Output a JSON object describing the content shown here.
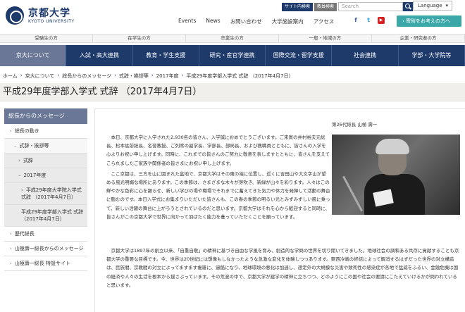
{
  "header": {
    "logo_jp": "京都大学",
    "logo_en": "KYOTO UNIVERSITY",
    "sitemap_btn": "サイト内検索",
    "staff_btn": "教員検索",
    "search_placeholder": "Search",
    "language": "Language",
    "nav": [
      "Events",
      "News",
      "お問い合わせ",
      "大学施設案内",
      "アクセス"
    ],
    "donate": "寄附をお考えの方へ"
  },
  "audience": [
    "受験生の方",
    "在学生の方",
    "卒業生の方",
    "一般・地域の方",
    "企業・研究者の方"
  ],
  "main_nav": [
    {
      "label": "京大について",
      "active": true
    },
    {
      "label": "入試・高大連携",
      "active": false
    },
    {
      "label": "教育・学生支援",
      "active": false
    },
    {
      "label": "研究・産官学連携",
      "active": false
    },
    {
      "label": "国際交流・留学支援",
      "active": false
    },
    {
      "label": "社会連携",
      "active": false
    },
    {
      "label": "学部・大学院等",
      "active": false
    }
  ],
  "breadcrumb": [
    "ホーム",
    "京大について",
    "総長からのメッセージ",
    "式辞・挨拶等",
    "2017年度",
    "平成29年度学部入学式 式辞 （2017年4月7日）"
  ],
  "page_title": "平成29年度学部入学式 式辞 （2017年4月7日）",
  "sidebar": {
    "heading": "総長からのメッセージ",
    "items": [
      {
        "label": "総長の動き",
        "level": 1
      },
      {
        "label": "式辞・挨拶等",
        "level": 2
      },
      {
        "label": "式辞",
        "level": 3
      },
      {
        "label": "2017年度",
        "level": 3
      },
      {
        "label": "平成29年度大学院入学式 式辞 （2017年4月7日）",
        "level": 4
      },
      {
        "label": "平成29年度学部入学式 式辞 （2017年4月7日）",
        "level": 4
      },
      {
        "label": "歴代総長",
        "level": 1
      },
      {
        "label": "山極壽一総長からのメッセージ",
        "level": 1
      },
      {
        "label": "山極壽一総長 特設サイト",
        "level": 1
      }
    ]
  },
  "content": {
    "president_label": "第26代総長 山極 壽一",
    "para1": "本日、京都大学に入学された2,930名の皆さん、入学誠におめでとうございます。ご来賓の井村裕夫元総長、松本紘前総長、名誉教授、ご列席の副学長、学部長、部局長、および教職員とともに、皆さんの入学を心よりお祝い申し上げます。同時に、これまでの皆さんのご努力に敬意を表しますとともに、皆さんを支えてこられましたご家族や関係者の皆さまにお祝い申し上げます。",
    "para2": "ここ京都は、三方を山に囲まれた盆地で、京都大学はその東の端に位置し、近くに吉田山や大文字山が望める風光明媚な場所にあります。この季節は、さまざまな木々が芽吹き、新緑が山々を彩ります。人々はこの鮮やかな色彩に心を躍らせ、新しい学びの場や職場でそれまでに蓄えてきた気力や体力を発揮して活動の舞台に臨むのです。本日入学式にお集まりいただいた皆さんも、この春の季節の明るい光とみずみずしい風に乗って、新しい活躍の舞台に上がろうとされているのだと思います。京都大学はそれを心から歓迎すると同時に、皆さんがこの京都大学で世界に向かって羽ばたく能力を養っていただくことを願っています。",
    "para3": "京都大学は1897年の創立以来、「自重自敬」の精神に基づき自由な学風を育み、創造的な学問の世界を切り開いてきました。地球社会の調和ある共存に貢献することも京都大学の重要な目標です。今、世界は20世紀には想像もしなかったような急激な変化を体験しつつあります。東西冷戦の終結によって解消するはずだった世界の対立構造は、民族間、宗教間の対立によってますます複雑に、過酷になり、地球環境の悪化は加速し、想定外の大規模な災害や致死性の感染症が各地で猛威をふるい、金融危機は国の経済や人々の生活を根本から揺さぶっています。その荒波の中で、京都大学が建学の精神に立ちつつ、どのようにこの国や社会の要請にこたえていけるかが問われていると思います。"
  },
  "colors": {
    "brand_navy": "#1d3a6b",
    "active_nav": "#6a7796",
    "donate_teal": "#3aa7a8"
  }
}
